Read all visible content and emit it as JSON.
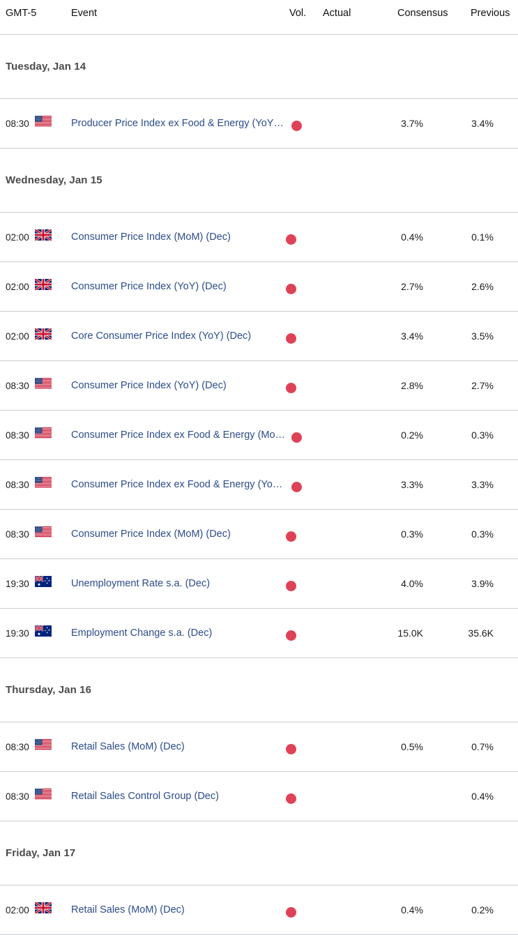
{
  "table": {
    "headers": {
      "time": "GMT-5",
      "event": "Event",
      "vol": "Vol.",
      "actual": "Actual",
      "consensus": "Consensus",
      "previous": "Previous"
    },
    "groups": [
      {
        "date": "Tuesday, Jan 14",
        "rows": [
          {
            "time": "08:30",
            "flag": "us-flag",
            "event": "Producer Price Index ex Food & Energy (YoY) (Dec)",
            "event_display": "Producer Price Index ex Food & Energy (YoY…",
            "truncated": true,
            "vol": "high-volatility-dot",
            "actual": "",
            "consensus": "3.7%",
            "previous": "3.4%"
          }
        ]
      },
      {
        "date": "Wednesday, Jan 15",
        "rows": [
          {
            "time": "02:00",
            "flag": "gb-flag",
            "event": "Consumer Price Index (MoM) (Dec)",
            "event_display": "Consumer Price Index (MoM) (Dec)",
            "truncated": false,
            "vol": "high-volatility-dot",
            "actual": "",
            "consensus": "0.4%",
            "previous": "0.1%"
          },
          {
            "time": "02:00",
            "flag": "gb-flag",
            "event": "Consumer Price Index (YoY) (Dec)",
            "event_display": "Consumer Price Index (YoY) (Dec)",
            "truncated": false,
            "vol": "high-volatility-dot",
            "actual": "",
            "consensus": "2.7%",
            "previous": "2.6%"
          },
          {
            "time": "02:00",
            "flag": "gb-flag",
            "event": "Core Consumer Price Index (YoY) (Dec)",
            "event_display": "Core Consumer Price Index (YoY) (Dec)",
            "truncated": false,
            "vol": "high-volatility-dot",
            "actual": "",
            "consensus": "3.4%",
            "previous": "3.5%"
          },
          {
            "time": "08:30",
            "flag": "us-flag",
            "event": "Consumer Price Index (YoY) (Dec)",
            "event_display": "Consumer Price Index (YoY) (Dec)",
            "truncated": false,
            "vol": "high-volatility-dot",
            "actual": "",
            "consensus": "2.8%",
            "previous": "2.7%"
          },
          {
            "time": "08:30",
            "flag": "us-flag",
            "event": "Consumer Price Index ex Food & Energy (MoM) (Dec)",
            "event_display": "Consumer Price Index ex Food & Energy (Mo…",
            "truncated": true,
            "vol": "high-volatility-dot",
            "actual": "",
            "consensus": "0.2%",
            "previous": "0.3%"
          },
          {
            "time": "08:30",
            "flag": "us-flag",
            "event": "Consumer Price Index ex Food & Energy (YoY) (Dec)",
            "event_display": "Consumer Price Index ex Food & Energy (Yo…",
            "truncated": true,
            "vol": "high-volatility-dot",
            "actual": "",
            "consensus": "3.3%",
            "previous": "3.3%"
          },
          {
            "time": "08:30",
            "flag": "us-flag",
            "event": "Consumer Price Index (MoM) (Dec)",
            "event_display": "Consumer Price Index (MoM) (Dec)",
            "truncated": false,
            "vol": "high-volatility-dot",
            "actual": "",
            "consensus": "0.3%",
            "previous": "0.3%"
          },
          {
            "time": "19:30",
            "flag": "au-flag",
            "event": "Unemployment Rate s.a. (Dec)",
            "event_display": "Unemployment Rate s.a. (Dec)",
            "truncated": false,
            "vol": "high-volatility-dot",
            "actual": "",
            "consensus": "4.0%",
            "previous": "3.9%"
          },
          {
            "time": "19:30",
            "flag": "au-flag",
            "event": "Employment Change s.a. (Dec)",
            "event_display": "Employment Change s.a. (Dec)",
            "truncated": false,
            "vol": "high-volatility-dot",
            "actual": "",
            "consensus": "15.0K",
            "previous": "35.6K"
          }
        ]
      },
      {
        "date": "Thursday, Jan 16",
        "rows": [
          {
            "time": "08:30",
            "flag": "us-flag",
            "event": "Retail Sales (MoM) (Dec)",
            "event_display": "Retail Sales (MoM) (Dec)",
            "truncated": false,
            "vol": "high-volatility-dot",
            "actual": "",
            "consensus": "0.5%",
            "previous": "0.7%"
          },
          {
            "time": "08:30",
            "flag": "us-flag",
            "event": "Retail Sales Control Group (Dec)",
            "event_display": "Retail Sales Control Group (Dec)",
            "truncated": false,
            "vol": "high-volatility-dot",
            "actual": "",
            "consensus": "",
            "previous": "0.4%"
          }
        ]
      },
      {
        "date": "Friday, Jan 17",
        "rows": [
          {
            "time": "02:00",
            "flag": "gb-flag",
            "event": "Retail Sales (MoM) (Dec)",
            "event_display": "Retail Sales (MoM) (Dec)",
            "truncated": false,
            "vol": "high-volatility-dot",
            "actual": "",
            "consensus": "0.4%",
            "previous": "0.2%"
          }
        ]
      }
    ]
  },
  "colors": {
    "link": "#2b4c8c",
    "volatility_high": "#df4257",
    "divider": "#c8cdd2",
    "date_header": "#4a4a4a"
  }
}
